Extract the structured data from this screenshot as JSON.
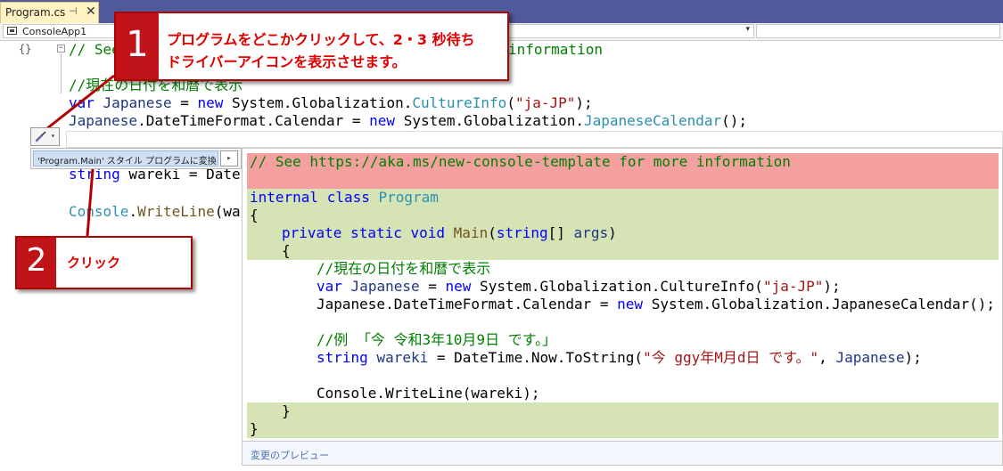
{
  "tab": {
    "title": "Program.cs",
    "pin": "⊣",
    "close": "✕"
  },
  "navbar": {
    "project": "ConsoleApp1",
    "arrow": "▾"
  },
  "editor": {
    "gutter_mark": "{}",
    "line1_comment": "// See",
    "line1_tail": "information",
    "line3_comment": "//現在の日付を和暦で表示",
    "line4": {
      "kw": "var",
      "var": "Japanese",
      "eq": " = ",
      "new": "new",
      "ns": " System.Globalization.",
      "type": "CultureInfo",
      "open": "(",
      "str": "\"ja-JP\"",
      "close": ");"
    },
    "line5": {
      "var": "Japanese",
      "mid": ".DateTimeFormat.Calendar = ",
      "new": "new",
      "ns": " System.Globalization.",
      "type": "JapaneseCalendar",
      "close": "();"
    },
    "line7": {
      "kw": "string",
      "rest": " wareki = Date"
    },
    "line9": {
      "cls": "Console",
      "rest": ".",
      "mt": "WriteLine",
      "tail": "(war"
    }
  },
  "callouts": {
    "one": {
      "num": "1",
      "line1": "プログラムをどこかクリックして、2・3 秒待ち",
      "line2": "ドライバーアイコンを表示させます。"
    },
    "two": {
      "num": "2",
      "text": "クリック"
    }
  },
  "quick_action": {
    "icon": "screwdriver-icon",
    "glyph": "🪛",
    "dropdown": "▾",
    "item": "'Program.Main' スタイル プログラムに変換",
    "submenu_arrow": "▸"
  },
  "preview": {
    "l1": "// See https://aka.ms/new-console-template for more information",
    "l2": {
      "kw": "internal class",
      "type": "Program"
    },
    "l3": "{",
    "l4": {
      "kw": "private static void",
      "mt": "Main",
      "open": "(",
      "kw2": "string",
      "mid": "[] ",
      "pm": "args",
      "close": ")"
    },
    "l5": "{",
    "l6": "//現在の日付を和暦で表示",
    "l7": {
      "kw": "var",
      "var": "Japanese",
      "eq": " = ",
      "new": "new",
      "rest": " System.Globalization.CultureInfo(",
      "str": "\"ja-JP\"",
      "close": ");"
    },
    "l8": {
      "pre": "Japanese.DateTimeFormat.Calendar = ",
      "new": "new",
      "rest": " System.Globalization.JapaneseCalendar();"
    },
    "l9": "//例 「今 令和3年10月9日 です。」",
    "l10": {
      "kw": "string",
      "var": "wareki",
      "mid": " = DateTime.Now.ToString(",
      "str": "\"今 ggy年M月d日 です。\"",
      "tail": ", ",
      "pm": "Japanese",
      "close": ");"
    },
    "l11": "Console.WriteLine(wareki);",
    "l12": "}",
    "l13": "}",
    "footer": "変更のプレビュー"
  },
  "colors": {
    "callout_red": "#c0141a",
    "removed": "#f4a0a0",
    "added": "#d6e3b5",
    "tabstrip": "#4f5a9c"
  }
}
